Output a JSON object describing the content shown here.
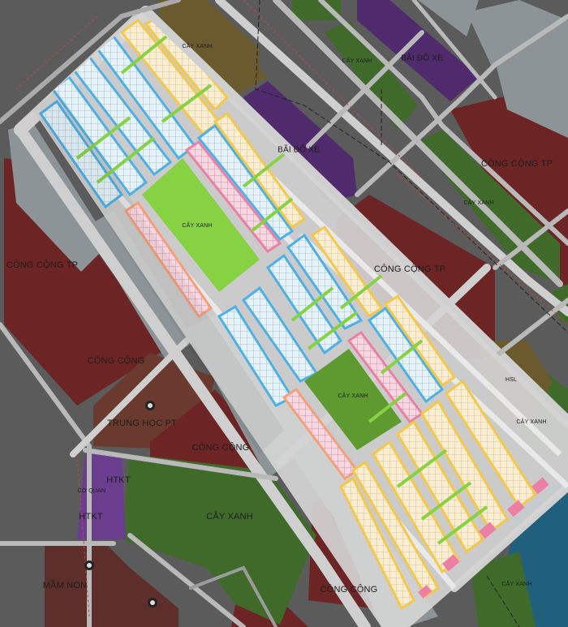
{
  "map": {
    "labels": {
      "cay_xanh_top_left": "CÂY XANH",
      "cay_xanh_top_mid": "CÂY XANH",
      "bai_do_xe_top": "BÃI ĐỖ XE",
      "bai_do_xe_mid": "BÃI ĐỖ XE",
      "cong_cong_tp_right": "CÔNG CỘNG TP",
      "cay_xanh_right_strip": "CÂY XANH",
      "cay_xanh_inner_top": "CÂY XANH",
      "cong_cong_tp_mid": "CÔNG CỘNG TP",
      "cong_cong_tp_left": "CÔNG CỘNG TP",
      "cong_cong_left": "CÔNG CỘNG",
      "cay_xanh_inner_mid": "CÂY XANH",
      "trung_hoc_pt": "TRUNG HỌC PT",
      "cong_cong_center": "CÔNG CỘNG",
      "htkt_top": "HTKT",
      "co_quan": "CƠ QUAN",
      "htkt_bottom": "HTKT",
      "cay_xanh_bottom": "CÂY XANH",
      "mam_non": "MẦM NON",
      "cong_cong_bottom": "CÔNG CỘNG",
      "cay_xanh_right_mid": "CÂY XANH",
      "cay_xanh_bottom_right": "CÂY XANH",
      "hsl": "HSL"
    },
    "colors": {
      "road": "#cfcfcf",
      "block_gray": "#8a9196",
      "public_red": "#6e2323",
      "school_brown": "#6a3a2e",
      "green_dark": "#3f6a2a",
      "green_bright": "#86d243",
      "green_mid": "#5e9a30",
      "parking_purple": "#4f2a6c",
      "tech_purple": "#6a3d8f",
      "lot_yellow": "#f7d67a",
      "lot_pink": "#f2a7c4",
      "lot_salmon": "#f4a07a",
      "lot_blue": "#8ed0f2",
      "lot_cream": "#f8e9c4",
      "water": "#1f5f7d"
    }
  }
}
